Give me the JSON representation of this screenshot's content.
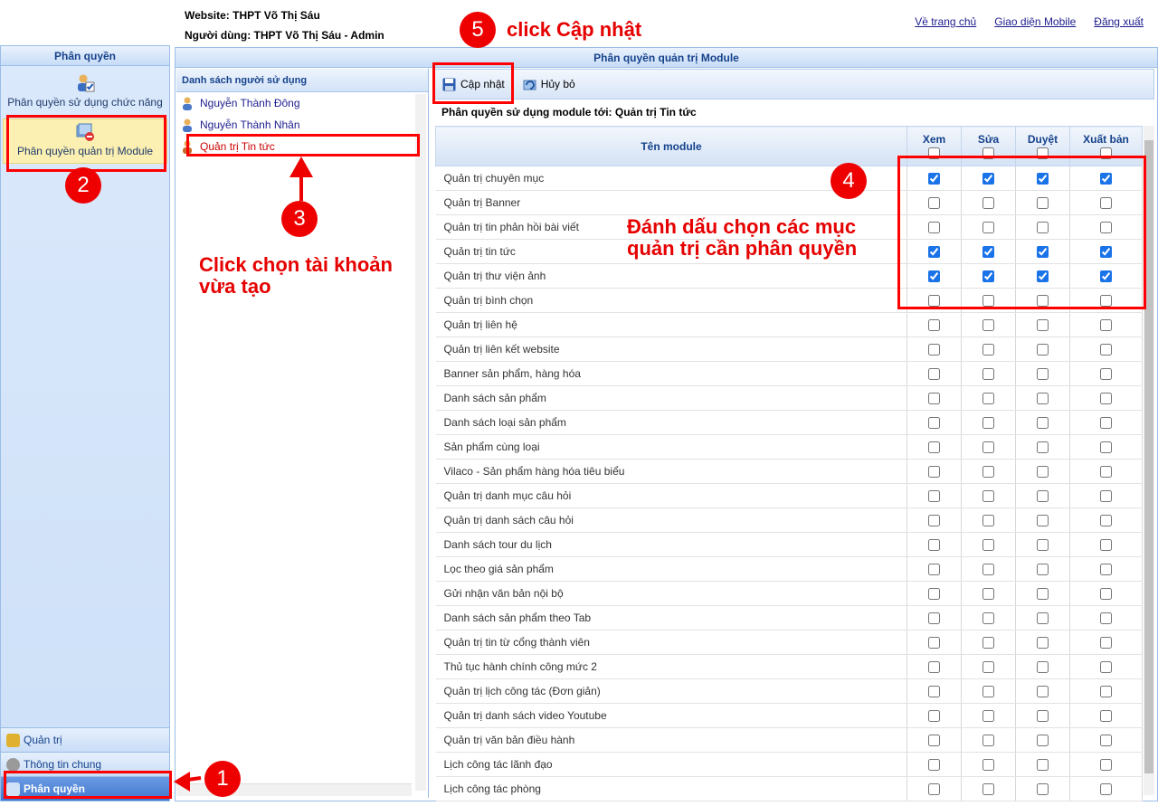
{
  "header": {
    "website": "Website: THPT Võ Thị Sáu",
    "user": "Người dùng: THPT Võ Thị Sáu - Admin",
    "links": [
      "Về trang chủ",
      "Giao diện Mobile",
      "Đăng xuất"
    ]
  },
  "left": {
    "title": "Phân quyền",
    "items": [
      "Phân quyền sử dụng chức năng",
      "Phân quyền quản trị Module"
    ],
    "nav": [
      "Quản trị",
      "Thông tin chung",
      "Phân quyền"
    ]
  },
  "main": {
    "title": "Phân quyền quản trị Module",
    "users_title": "Danh sách người sử dụng",
    "users": [
      "Nguyễn Thành Đông",
      "Nguyễn Thành Nhân",
      "Quản trị Tin tức"
    ],
    "toolbar": {
      "update": "Cập nhật",
      "cancel": "Hủy bỏ"
    },
    "grant_title": "Phân quyền sử dụng module tới: Quản trị Tin tức",
    "columns": [
      "Tên module",
      "Xem",
      "Sửa",
      "Duyệt",
      "Xuất bản"
    ],
    "modules": [
      {
        "name": "Quản trị chuyên mục",
        "checked": [
          true,
          true,
          true,
          true
        ]
      },
      {
        "name": "Quản trị Banner",
        "checked": [
          false,
          false,
          false,
          false
        ]
      },
      {
        "name": "Quản trị tin phản hồi bài viết",
        "checked": [
          false,
          false,
          false,
          false
        ]
      },
      {
        "name": "Quản trị tin tức",
        "checked": [
          true,
          true,
          true,
          true
        ]
      },
      {
        "name": "Quản trị thư viện ảnh",
        "checked": [
          true,
          true,
          true,
          true
        ]
      },
      {
        "name": "Quản trị bình chọn",
        "checked": [
          false,
          false,
          false,
          false
        ]
      },
      {
        "name": "Quản trị liên hệ",
        "checked": [
          false,
          false,
          false,
          false
        ]
      },
      {
        "name": "Quản trị liên kết website",
        "checked": [
          false,
          false,
          false,
          false
        ]
      },
      {
        "name": "Banner sản phẩm, hàng hóa",
        "checked": [
          false,
          false,
          false,
          false
        ]
      },
      {
        "name": "Danh sách sản phẩm",
        "checked": [
          false,
          false,
          false,
          false
        ]
      },
      {
        "name": "Danh sách loại sản phẩm",
        "checked": [
          false,
          false,
          false,
          false
        ]
      },
      {
        "name": "Sản phẩm cùng loại",
        "checked": [
          false,
          false,
          false,
          false
        ]
      },
      {
        "name": "Vilaco - Sản phẩm hàng hóa tiêu biểu",
        "checked": [
          false,
          false,
          false,
          false
        ]
      },
      {
        "name": "Quản trị danh mục câu hỏi",
        "checked": [
          false,
          false,
          false,
          false
        ]
      },
      {
        "name": "Quản trị danh sách câu hỏi",
        "checked": [
          false,
          false,
          false,
          false
        ]
      },
      {
        "name": "Danh sách tour du lịch",
        "checked": [
          false,
          false,
          false,
          false
        ]
      },
      {
        "name": "Lọc theo giá sản phẩm",
        "checked": [
          false,
          false,
          false,
          false
        ]
      },
      {
        "name": "Gửi nhận văn bản nội bộ",
        "checked": [
          false,
          false,
          false,
          false
        ]
      },
      {
        "name": "Danh sách sản phẩm theo Tab",
        "checked": [
          false,
          false,
          false,
          false
        ]
      },
      {
        "name": "Quản trị tin từ cổng thành viên",
        "checked": [
          false,
          false,
          false,
          false
        ]
      },
      {
        "name": "Thủ tục hành chính công mức 2",
        "checked": [
          false,
          false,
          false,
          false
        ]
      },
      {
        "name": "Quản trị lịch công tác (Đơn giản)",
        "checked": [
          false,
          false,
          false,
          false
        ]
      },
      {
        "name": "Quản trị danh sách video Youtube",
        "checked": [
          false,
          false,
          false,
          false
        ]
      },
      {
        "name": "Quản trị văn bản điều hành",
        "checked": [
          false,
          false,
          false,
          false
        ]
      },
      {
        "name": "Lịch công tác lãnh đạo",
        "checked": [
          false,
          false,
          false,
          false
        ]
      },
      {
        "name": "Lịch công tác phòng",
        "checked": [
          false,
          false,
          false,
          false
        ]
      }
    ]
  },
  "annotations": {
    "step1": "1",
    "step2": "2",
    "step3": "3",
    "step4": "4",
    "step5": "5",
    "step5_text": "click Cập nhật",
    "step3_text_line1": "Click chọn tài khoản",
    "step3_text_line2": "vừa tạo",
    "step4_text_line1": "Đánh dấu chọn các mục",
    "step4_text_line2": "quản trị cần phân quyền",
    "color": "#e00000"
  }
}
